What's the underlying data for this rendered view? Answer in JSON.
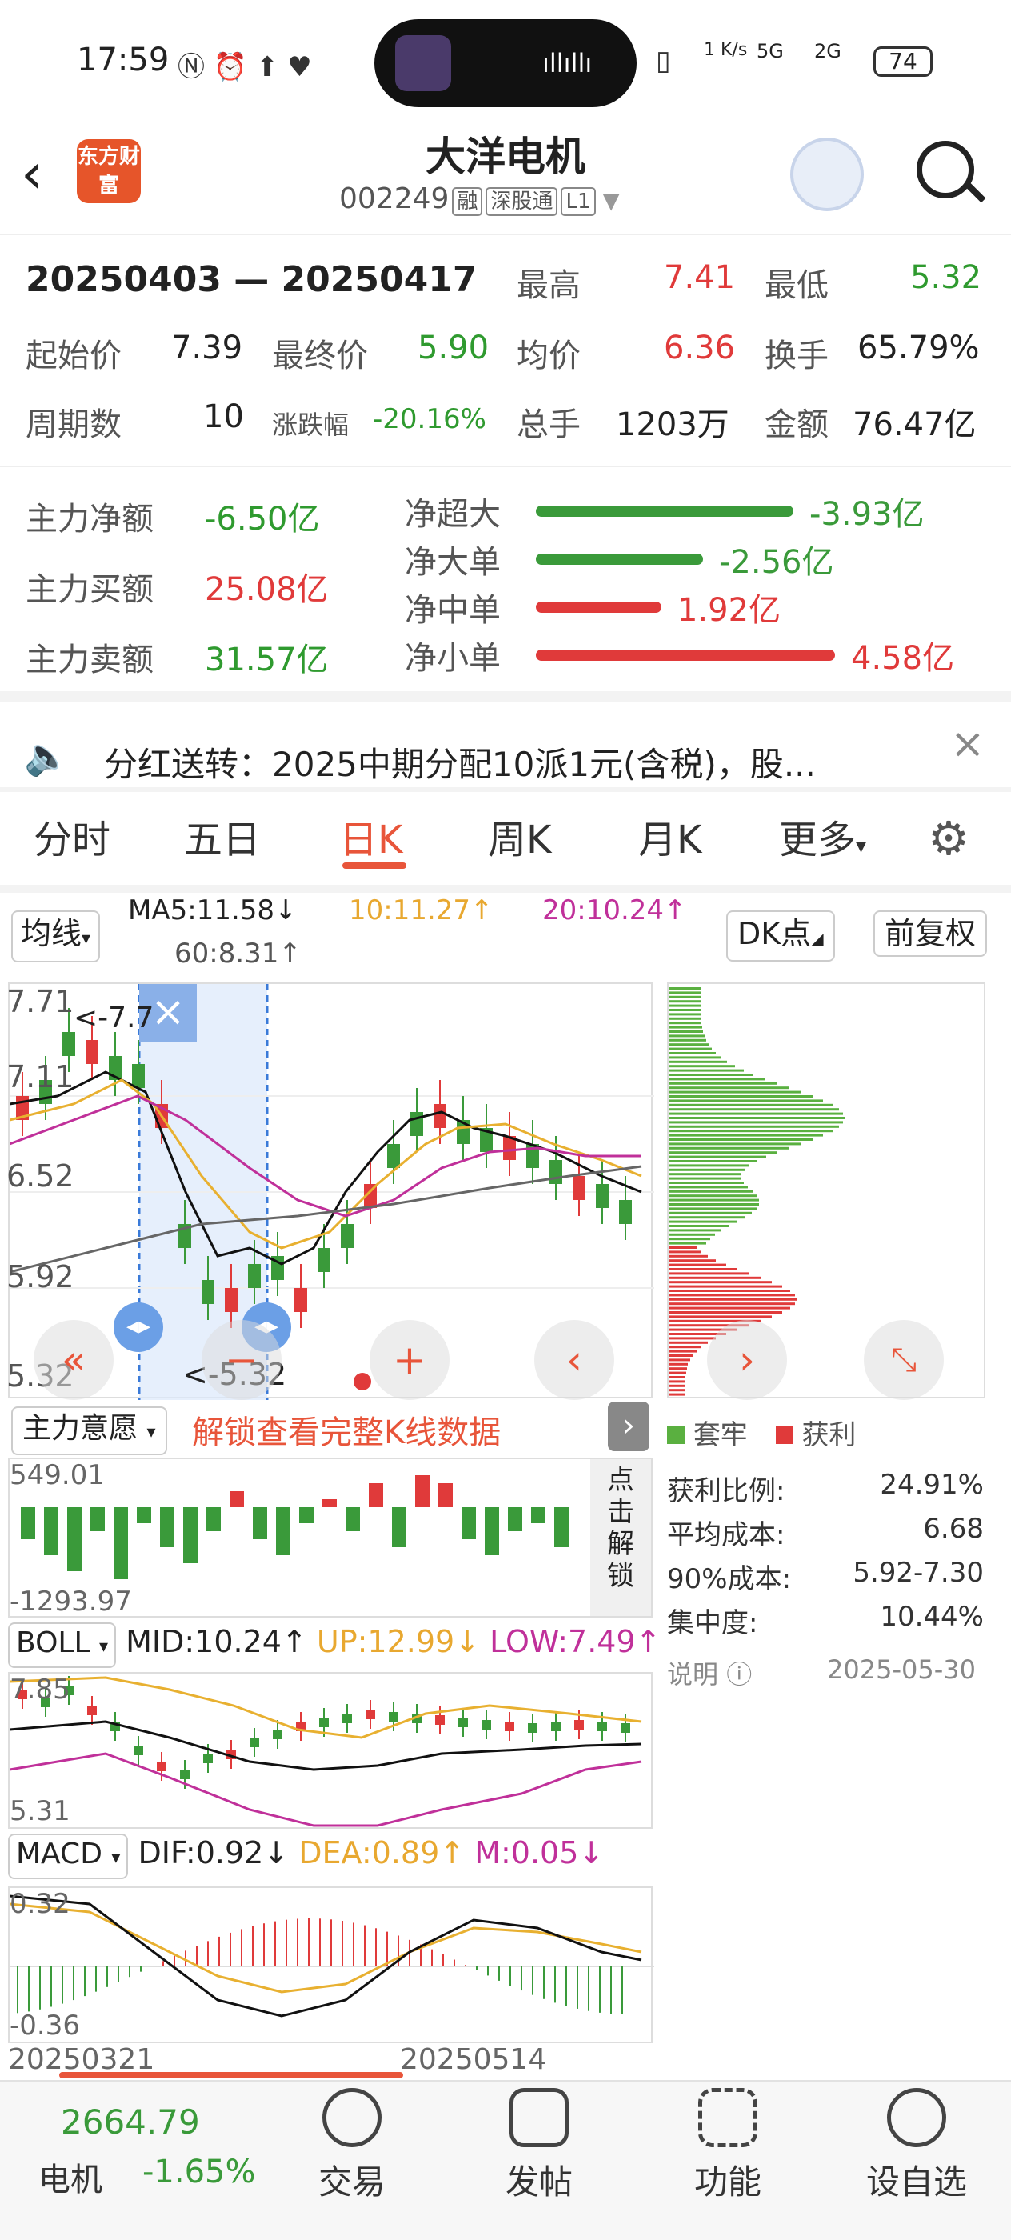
{
  "status_bar": {
    "time": "17:59",
    "net_speed": "1 K/s",
    "net_1": "5G",
    "net_2": "2G",
    "battery": "74"
  },
  "header": {
    "logo_text": "东方财富",
    "title": "大洋电机",
    "code": "002249",
    "tags": [
      "融",
      "深股通",
      "L1"
    ]
  },
  "summary": {
    "date_range": "20250403 — 20250417",
    "high_label": "最高",
    "high": "7.41",
    "low_label": "最低",
    "low": "5.32",
    "open_label": "起始价",
    "open": "7.39",
    "close_label": "最终价",
    "close": "5.90",
    "avg_label": "均价",
    "avg": "6.36",
    "turnover_label": "换手",
    "turnover": "65.79%",
    "periods_label": "周期数",
    "periods": "10",
    "change_label": "涨跌幅",
    "change": "-20.16%",
    "volume_label": "总手",
    "volume": "1203万",
    "amount_label": "金额",
    "amount": "76.47亿"
  },
  "capital_flow": {
    "net_label": "主力净额",
    "net": "-6.50亿",
    "buy_label": "主力买额",
    "buy": "25.08亿",
    "sell_label": "主力卖额",
    "sell": "31.57亿",
    "bars": [
      {
        "label": "净超大",
        "value": "-3.93亿",
        "fraction": 0.86,
        "color": "#3a9a3a"
      },
      {
        "label": "净大单",
        "value": "-2.56亿",
        "fraction": 0.56,
        "color": "#3a9a3a"
      },
      {
        "label": "净中单",
        "value": "1.92亿",
        "fraction": 0.42,
        "color": "#e03a3a"
      },
      {
        "label": "净小单",
        "value": "4.58亿",
        "fraction": 1.0,
        "color": "#e03a3a"
      }
    ]
  },
  "notice": {
    "text": "分红送转：2025中期分配10派1元(含税)，股..."
  },
  "tabs": [
    "分时",
    "五日",
    "日K",
    "周K",
    "月K",
    "更多"
  ],
  "active_tab": "日K",
  "ma_bar": {
    "selector": "均线",
    "ma5": "MA5:11.58↓",
    "ma10": "10:11.27↑",
    "ma20": "20:10.24↑",
    "ma60": "60:8.31↑",
    "dk": "DK点",
    "fq": "前复权"
  },
  "kline": {
    "y_labels": [
      "7.71",
      "7.11",
      "6.52",
      "5.92",
      "5.32"
    ],
    "top_marker": "<-7.7",
    "low_marker": "<-5.32"
  },
  "main_force": {
    "selector": "主力意愿",
    "unlock": "解锁查看完整K线数据",
    "side": "点击解锁",
    "y_top": "549.01",
    "y_bottom": "-1293.97"
  },
  "boll": {
    "selector": "BOLL",
    "mid": "MID:10.24↑",
    "up": "UP:12.99↓",
    "low": "LOW:7.49↑",
    "y_top": "7.85",
    "y_bottom": "5.31"
  },
  "macd": {
    "selector": "MACD",
    "dif": "DIF:0.92↓",
    "dea": "DEA:0.89↑",
    "m": "M:0.05↓",
    "y_top": "0.32",
    "y_bottom": "-0.36"
  },
  "dates": {
    "left": "20250321",
    "right": "20250514"
  },
  "chips": {
    "legend_trapped": "套牢",
    "legend_profit": "获利",
    "rows": [
      {
        "label": "获利比例:",
        "value": "24.91%"
      },
      {
        "label": "平均成本:",
        "value": "6.68"
      },
      {
        "label": "90%成本:",
        "value": "5.92-7.30"
      },
      {
        "label": "集中度:",
        "value": "10.44%"
      }
    ],
    "note_label": "说明",
    "note_date": "2025-05-30"
  },
  "bottom_nav": {
    "index_value": "2664.79",
    "index_name": "电机",
    "index_change": "-1.65%",
    "items": [
      "交易",
      "发帖",
      "功能",
      "设自选"
    ]
  },
  "colors": {
    "up": "#e03a3a",
    "down": "#3a9a3a",
    "accent": "#e8553a"
  }
}
